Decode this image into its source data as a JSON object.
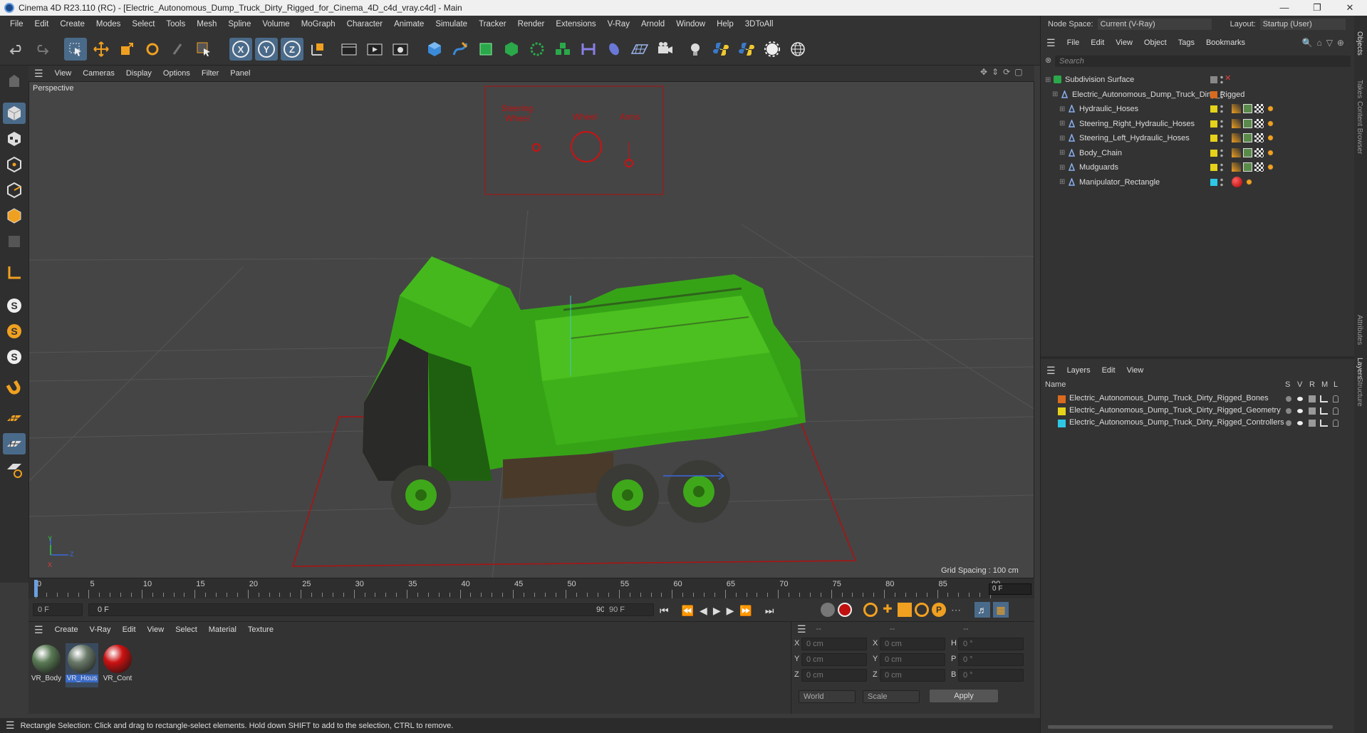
{
  "window": {
    "title": "Cinema 4D R23.110 (RC) - [Electric_Autonomous_Dump_Truck_Dirty_Rigged_for_Cinema_4D_c4d_vray.c4d] - Main"
  },
  "menubar": {
    "items": [
      "File",
      "Edit",
      "Create",
      "Modes",
      "Select",
      "Tools",
      "Mesh",
      "Spline",
      "Volume",
      "MoGraph",
      "Character",
      "Animate",
      "Simulate",
      "Tracker",
      "Render",
      "Extensions",
      "V-Ray",
      "Arnold",
      "Window",
      "Help",
      "3DToAll"
    ]
  },
  "viewport": {
    "menu": [
      "View",
      "Cameras",
      "Display",
      "Options",
      "Filter",
      "Panel"
    ],
    "label": "Perspective",
    "grid_spacing": "Grid Spacing : 100 cm",
    "controller_labels": [
      "Steering Wheel",
      "Wheel",
      "Arms"
    ],
    "axis_labels": [
      "Y",
      "Z",
      "X"
    ]
  },
  "timeline": {
    "ticks": [
      "0",
      "5",
      "10",
      "15",
      "20",
      "25",
      "30",
      "35",
      "40",
      "45",
      "50",
      "55",
      "60",
      "65",
      "70",
      "75",
      "80",
      "85",
      "90"
    ],
    "current_frame": "0 F"
  },
  "transport": {
    "start": "0 F",
    "range_start": "0 F",
    "range_end": "90 F",
    "end": "90 F"
  },
  "materials": {
    "menu": [
      "Create",
      "V-Ray",
      "Edit",
      "View",
      "Select",
      "Material",
      "Texture"
    ],
    "items": [
      {
        "name": "VR_Body",
        "color": "#5a7a55"
      },
      {
        "name": "VR_Hous",
        "color": "#6a7a6a"
      },
      {
        "name": "VR_Cont",
        "color": "#cc1111"
      }
    ]
  },
  "coords": {
    "header": [
      "--",
      "--",
      "--"
    ],
    "rows": [
      {
        "a": "X",
        "av": "0 cm",
        "b": "X",
        "bv": "0 cm",
        "c": "H",
        "cv": "0 °"
      },
      {
        "a": "Y",
        "av": "0 cm",
        "b": "Y",
        "bv": "0 cm",
        "c": "P",
        "cv": "0 °"
      },
      {
        "a": "Z",
        "av": "0 cm",
        "b": "Z",
        "bv": "0 cm",
        "c": "B",
        "cv": "0 °"
      }
    ],
    "world": "World",
    "scale": "Scale",
    "apply": "Apply"
  },
  "status": {
    "text": "Rectangle Selection: Click and drag to rectangle-select elements. Hold down SHIFT to add to the selection, CTRL to remove."
  },
  "right": {
    "nodespace_label": "Node Space:",
    "nodespace_value": "Current (V-Ray)",
    "layout_label": "Layout:",
    "layout_value": "Startup (User)",
    "obj_menu": [
      "File",
      "Edit",
      "View",
      "Object",
      "Tags",
      "Bookmarks"
    ],
    "search_placeholder": "Search",
    "objects": [
      {
        "name": "Subdivision Surface",
        "color": ""
      },
      {
        "name": "Electric_Autonomous_Dump_Truck_Dirty_Rigged",
        "color": "#d96a1e"
      },
      {
        "name": "Hydraulic_Hoses",
        "color": "#e5d21a"
      },
      {
        "name": "Steering_Right_Hydraulic_Hoses",
        "color": "#e5d21a"
      },
      {
        "name": "Steering_Left_Hydraulic_Hoses",
        "color": "#e5d21a"
      },
      {
        "name": "Body_Chain",
        "color": "#e5d21a"
      },
      {
        "name": "Mudguards",
        "color": "#e5d21a"
      },
      {
        "name": "Manipulator_Rectangle",
        "color": "#2ec8e6"
      }
    ],
    "layers_menu": [
      "Layers",
      "Edit",
      "View"
    ],
    "layers_header": {
      "name": "Name",
      "s": "S",
      "v": "V",
      "r": "R",
      "m": "M",
      "l": "L"
    },
    "layers": [
      {
        "name": "Electric_Autonomous_Dump_Truck_Dirty_Rigged_Bones",
        "color": "#d96a1e"
      },
      {
        "name": "Electric_Autonomous_Dump_Truck_Dirty_Rigged_Geometry",
        "color": "#e5d21a"
      },
      {
        "name": "Electric_Autonomous_Dump_Truck_Dirty_Rigged_Controllers",
        "color": "#2ec8e6"
      }
    ],
    "side_tabs": [
      "Objects",
      "Takes",
      "Content Browser",
      "Attributes",
      "Layers",
      "Structure"
    ]
  }
}
